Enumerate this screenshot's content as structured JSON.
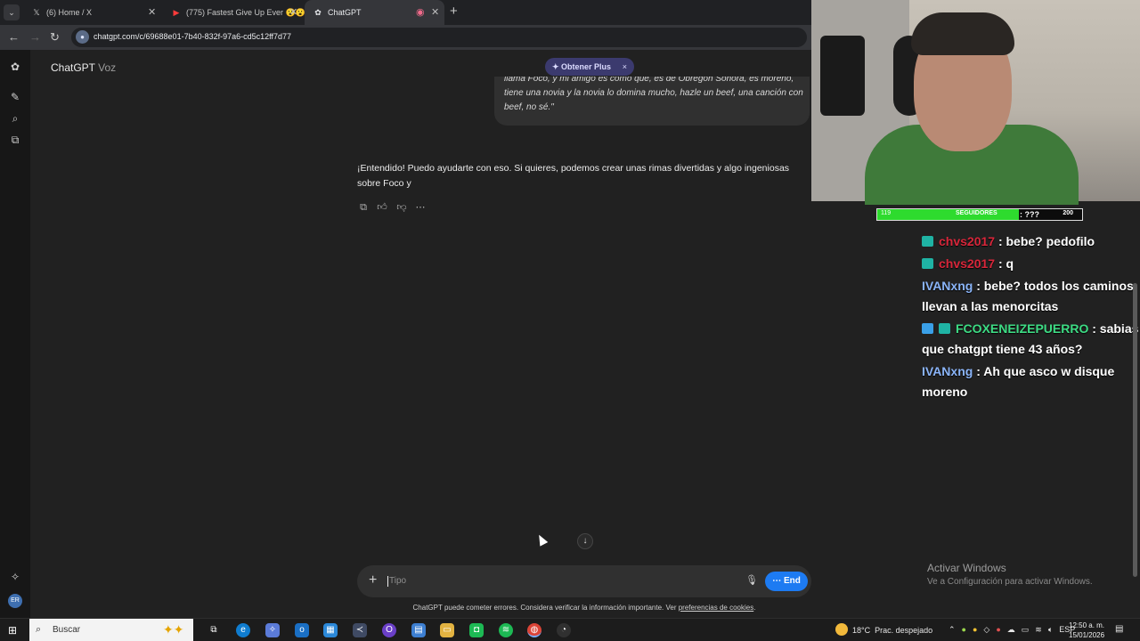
{
  "browser": {
    "tabs": [
      {
        "icon": "x-logo-icon",
        "title": "(6) Home / X"
      },
      {
        "icon": "youtube-icon",
        "title": "(775) Fastest Give Up Ever 😮😮"
      },
      {
        "icon": "chatgpt-icon",
        "title": "ChatGPT",
        "active": true
      }
    ],
    "new_tab": "+",
    "url": "chatgpt.com/c/69688e01-7b40-832f-97a6-cd5c12ff7d77"
  },
  "chatgpt": {
    "app_name": "ChatGPT",
    "mode": "Voz",
    "plus_pill": "✦ Obtener Plus",
    "plus_close": "×",
    "user_message": "llama Foco, y mi amigo es como que, es de Obregón Sonora, es moreno, tiene una novia y la novia lo domina mucho, hazle un beef, una canción con beef, no sé.\"",
    "assistant_message": "¡Entendido! Puedo ayudarte con eso. Si quieres, podemos crear unas rimas divertidas y algo ingeniosas sobre Foco y",
    "composer_placeholder": "Tipo",
    "end_button": "End",
    "disclaimer": "ChatGPT puede cometer errores. Considera verificar la información importante. Ver ",
    "disclaimer_link": "preferencias de cookies",
    "disclaimer_end": ".",
    "avatar_initials": "ER"
  },
  "stream": {
    "followers": {
      "min": "119",
      "label": "SEGUIDORES",
      "max": "200",
      "overlap_text": ": ???",
      "progress": 0.69
    },
    "chat": [
      {
        "user": "chvs2017",
        "color": "#d8263a",
        "text": ": bebe? pedofilo"
      },
      {
        "user": "chvs2017",
        "color": "#d8263a",
        "text": ": q"
      },
      {
        "user": "IVANxng",
        "color": "#8ab4f8",
        "text": ": bebe? todos los caminos llevan a las menorcitas"
      },
      {
        "user": "FCOXENEIZEPUERRO",
        "color": "#3ddc84",
        "text": ": sabias que chatgpt tiene 43 años?"
      },
      {
        "user": "IVANxng",
        "color": "#8ab4f8",
        "text": ": Ah que asco w disque moreno"
      }
    ],
    "activate_title": "Activar Windows",
    "activate_sub": "Ve a Configuración para activar Windows."
  },
  "taskbar": {
    "search_placeholder": "Buscar",
    "weather_temp": "18°C",
    "weather_desc": "Prac. despejado",
    "language": "ESP",
    "time": "12:50 a. m.",
    "date": "15/01/2026"
  }
}
